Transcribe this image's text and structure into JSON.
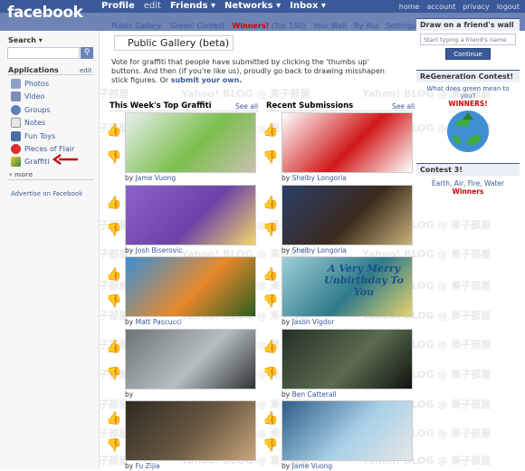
{
  "topnav": {
    "logo": "facebook",
    "profile": "Profile",
    "edit": "edit",
    "friends": "Friends ▾",
    "networks": "Networks ▾",
    "inbox": "Inbox ▾",
    "home": "home",
    "account": "account",
    "privacy": "privacy",
    "logout": "logout"
  },
  "sidebar": {
    "search_label": "Search ▾",
    "applications": "Applications",
    "edit": "edit",
    "items": [
      {
        "label": "Photos"
      },
      {
        "label": "Video"
      },
      {
        "label": "Groups"
      },
      {
        "label": "Notes"
      },
      {
        "label": "Fun Toys"
      },
      {
        "label": "Pieces of Flair"
      },
      {
        "label": "Graffiti"
      }
    ],
    "more": "▾ more",
    "advertise": "Advertise on Facebook"
  },
  "tabs": {
    "public_gallery": "Public Gallery",
    "green_contest": "'Green' Contest - ",
    "winners": "Winners!",
    "top150": "(Top 150)",
    "your_wall": "Your Wall",
    "by_you": "By You",
    "settings": "Settings"
  },
  "page_title": "Public Gallery (beta)",
  "intro": {
    "text": "Vote for graffiti that people have submitted by clicking the 'thumbs up' buttons. And then (if you're like us), proudly go back to drawing misshapen stick figures. Or ",
    "link": "submit your own."
  },
  "columns": {
    "top": "This Week's Top Graffiti",
    "recent": "Recent Submissions",
    "see_all": "See all"
  },
  "top_graffiti": [
    {
      "author": "Jame Vuong",
      "colors": [
        "#e8eef0",
        "#7bbf4d",
        "#c9c0b0"
      ]
    },
    {
      "author": "Josh Biserovic",
      "colors": [
        "#8b63c9",
        "#6a42a8",
        "#f4d66a"
      ]
    },
    {
      "author": "Matt Pascucci",
      "colors": [
        "#3a8fd6",
        "#e8892b",
        "#2b5e20"
      ]
    },
    {
      "author": "",
      "colors": [
        "#6c7478",
        "#b6bec2",
        "#2f3436"
      ]
    },
    {
      "author": "Fu Zijia",
      "colors": [
        "#2e2a22",
        "#6b5a44",
        "#c9a67a"
      ]
    }
  ],
  "recent_submissions": [
    {
      "author": "Shelby Longoria",
      "colors": [
        "#ffffff",
        "#d01818",
        "#ffffff"
      ]
    },
    {
      "author": "Shelby Longoria",
      "colors": [
        "#2b3f66",
        "#3a2a1e",
        "#c8b27a"
      ]
    },
    {
      "author": "Jason Vigdor",
      "colors": [
        "#9fd0d8",
        "#2e7a8a",
        "#e5d36b"
      ],
      "art_text": "A Very Merry Unbirthday To You"
    },
    {
      "author": "Ben Catterall",
      "colors": [
        "#243127",
        "#5b6b4f",
        "#0f1410"
      ]
    },
    {
      "author": "Jame Vuong",
      "colors": [
        "#2d5c88",
        "#a8d0e8",
        "#e6e6e6"
      ]
    }
  ],
  "right": {
    "draw_title": "Draw on a friend's wall",
    "draw_placeholder": "Start typing a friend's name",
    "continue": "Continue",
    "regen_title": "ReGeneration Contest!",
    "regen_question": "What does green mean to you?",
    "winners": "WINNERS!",
    "contest3_title": "Contest 3!",
    "contest3_text": "Earth, Air, Fire, Water",
    "contest3_winners": "Winners"
  },
  "watermark": "Yahoo! BLOG @ 果子部屋"
}
